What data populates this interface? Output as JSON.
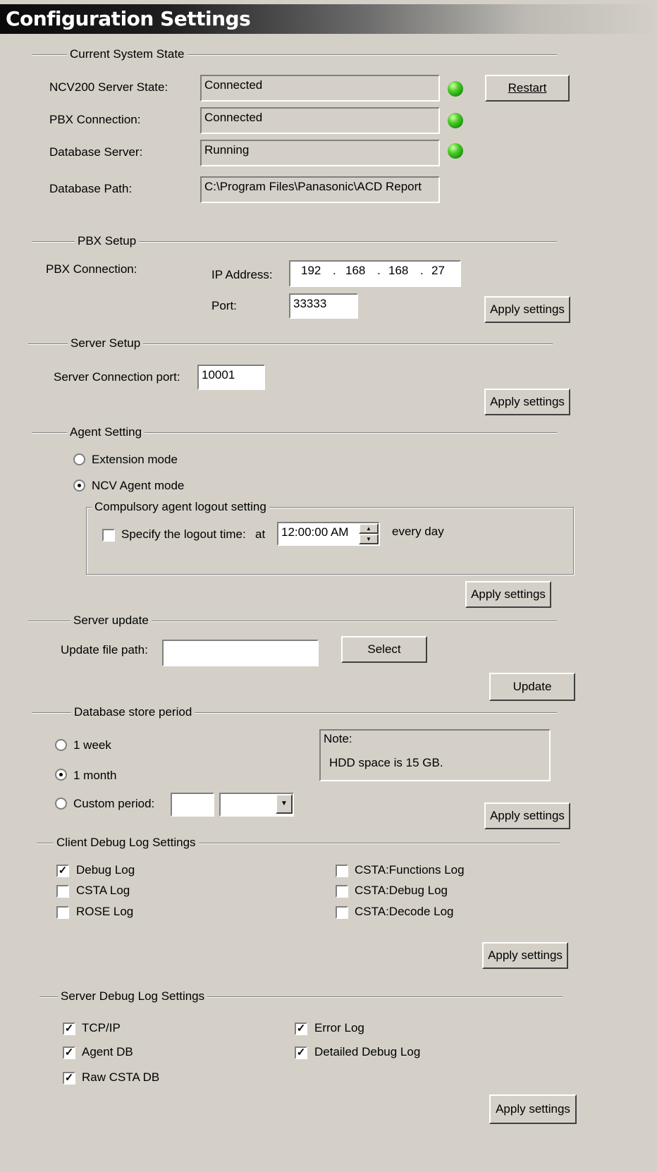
{
  "title": "Configuration Settings",
  "system_state": {
    "heading": "Current System State",
    "rows": [
      {
        "label": "NCV200 Server State:",
        "value": "Connected",
        "status": "green-led"
      },
      {
        "label": "PBX Connection:",
        "value": "Connected",
        "status": "green-led"
      },
      {
        "label": "Database Server:",
        "value": "Running",
        "status": "green-led"
      },
      {
        "label": "Database Path:",
        "value": "C:\\Program Files\\Panasonic\\ACD Report"
      }
    ],
    "restart_label": "Restart"
  },
  "pbx_setup": {
    "heading": "PBX Setup",
    "connection_label": "PBX Connection:",
    "ip_label": "IP Address:",
    "ip": [
      "192",
      "168",
      "168",
      "27"
    ],
    "port_label": "Port:",
    "port": "33333",
    "apply_label": "Apply settings"
  },
  "server_setup": {
    "heading": "Server Setup",
    "port_label": "Server Connection port:",
    "port": "10001",
    "apply_label": "Apply settings"
  },
  "agent_setting": {
    "heading": "Agent Setting",
    "modes": [
      {
        "label": "Extension mode",
        "selected": false
      },
      {
        "label": "NCV Agent mode",
        "selected": true
      }
    ],
    "logout_group": "Compulsory agent logout setting",
    "logout_check_label": "Specify the logout time:",
    "logout_checked": false,
    "at_label": "at",
    "time": "12:00:00 AM",
    "every_day_label": "every day",
    "apply_label": "Apply settings"
  },
  "server_update": {
    "heading": "Server update",
    "path_label": "Update file path:",
    "path_value": "",
    "select_label": "Select",
    "update_label": "Update"
  },
  "db_store": {
    "heading": "Database store period",
    "options": [
      {
        "label": "1 week",
        "selected": false
      },
      {
        "label": "1 month",
        "selected": true
      },
      {
        "label": "Custom period:",
        "selected": false
      }
    ],
    "custom_value": "",
    "custom_unit": "",
    "note_title": "Note:",
    "note_text": "HDD space is 15 GB.",
    "apply_label": "Apply settings"
  },
  "client_debug": {
    "heading": "Client Debug Log Settings",
    "left": [
      {
        "label": "Debug Log",
        "checked": true
      },
      {
        "label": "CSTA Log",
        "checked": false
      },
      {
        "label": "ROSE Log",
        "checked": false
      }
    ],
    "right": [
      {
        "label": "CSTA:Functions Log",
        "checked": false
      },
      {
        "label": "CSTA:Debug Log",
        "checked": false
      },
      {
        "label": "CSTA:Decode Log",
        "checked": false
      }
    ],
    "apply_label": "Apply settings"
  },
  "server_debug": {
    "heading": "Server Debug Log Settings",
    "left": [
      {
        "label": "TCP/IP",
        "checked": true
      },
      {
        "label": "Agent DB",
        "checked": true
      },
      {
        "label": "Raw CSTA DB",
        "checked": true
      }
    ],
    "right": [
      {
        "label": "Error Log",
        "checked": true
      },
      {
        "label": "Detailed Debug Log",
        "checked": true
      }
    ],
    "apply_label": "Apply settings"
  },
  "colors": {
    "background": "#d4d0c8",
    "led_green": "#3cc21e",
    "title_text": "#ffffff"
  }
}
